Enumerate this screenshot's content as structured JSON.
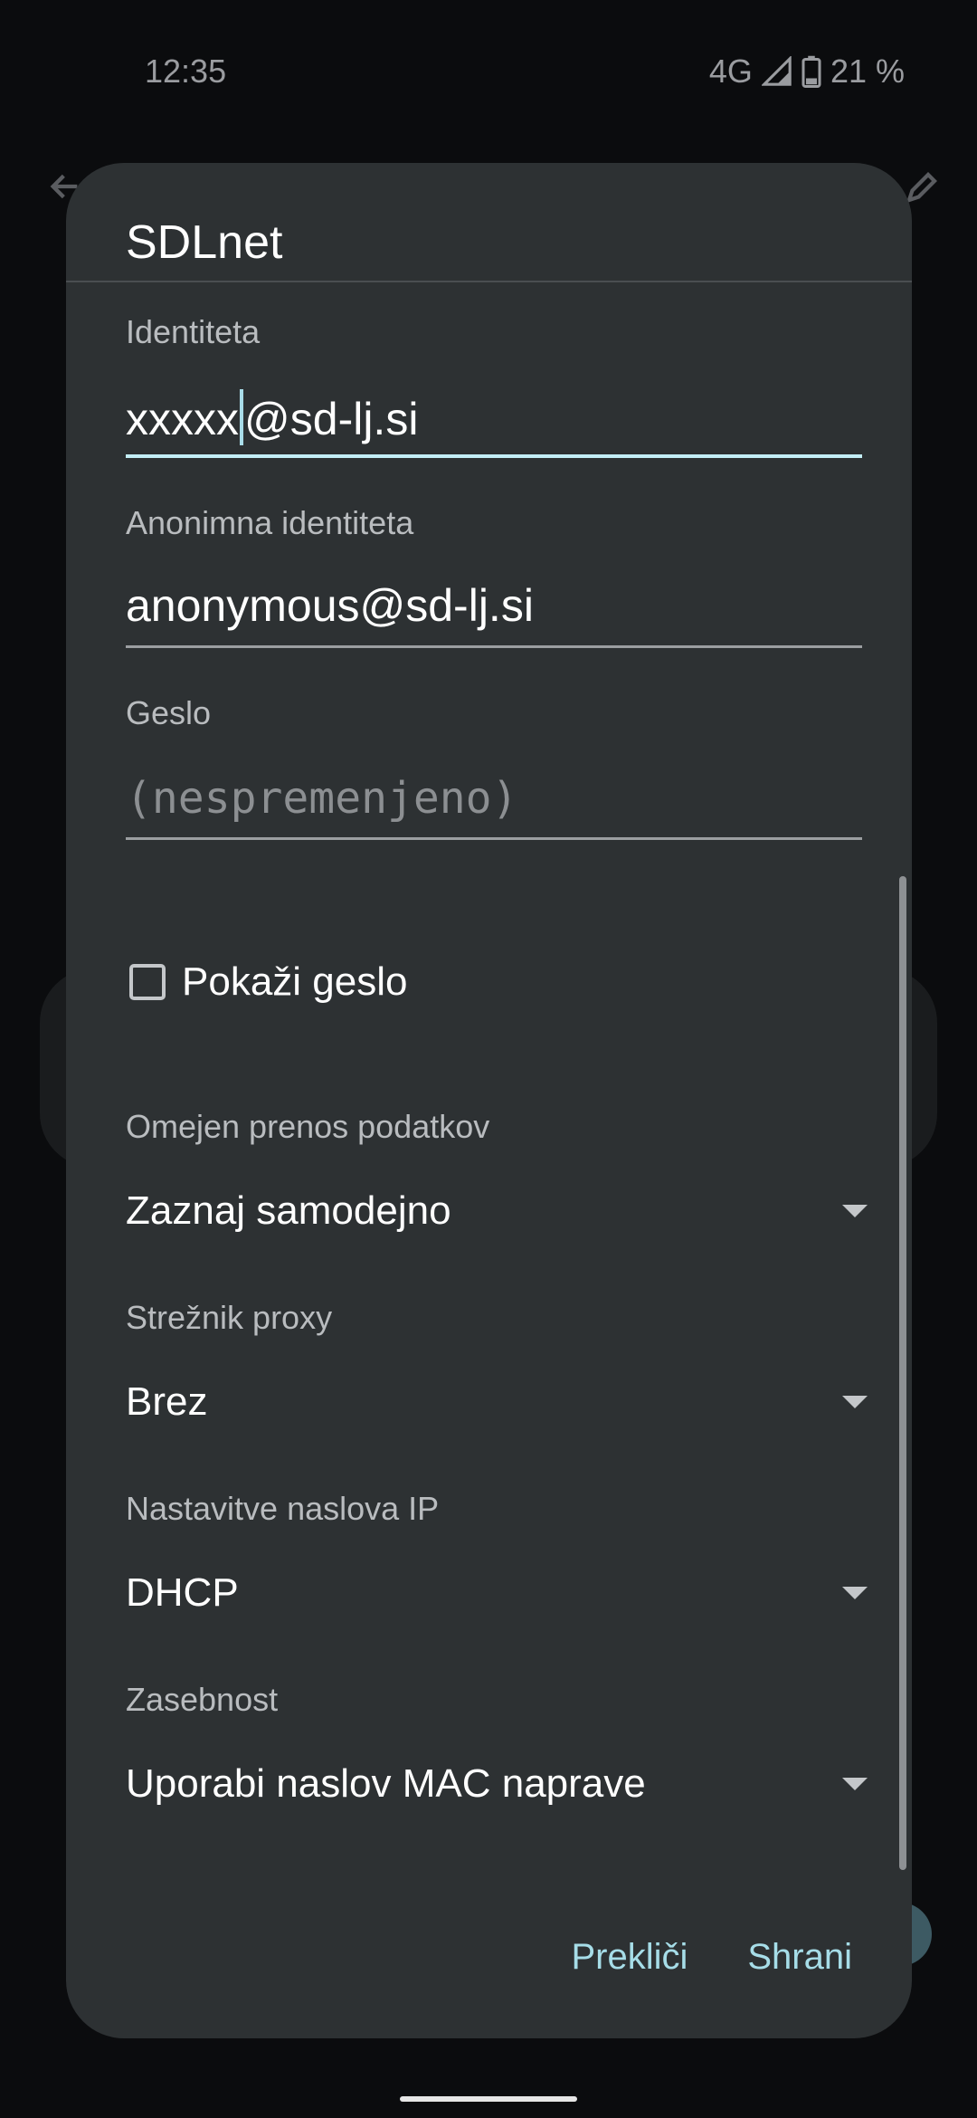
{
  "status_bar": {
    "time": "12:35",
    "network": "4G",
    "battery": "21 %"
  },
  "dialog": {
    "title": "SDLnet",
    "identity": {
      "label": "Identiteta",
      "value_before_cursor": "xxxxx",
      "value_after_cursor": "@sd-lj.si"
    },
    "anonymous_identity": {
      "label": "Anonimna identiteta",
      "value": "anonymous@sd-lj.si"
    },
    "password": {
      "label": "Geslo",
      "placeholder": "(nespremenjeno)"
    },
    "show_password": {
      "label": "Pokaži geslo",
      "checked": false
    },
    "metered": {
      "label": "Omejen prenos podatkov",
      "value": "Zaznaj samodejno"
    },
    "proxy": {
      "label": "Strežnik proxy",
      "value": "Brez"
    },
    "ip_settings": {
      "label": "Nastavitve naslova IP",
      "value": "DHCP"
    },
    "privacy": {
      "label": "Zasebnost",
      "value": "Uporabi naslov MAC naprave"
    },
    "actions": {
      "cancel": "Prekliči",
      "save": "Shrani"
    }
  },
  "colors": {
    "dialog_bg": "#2d3133",
    "accent": "#a6dde8",
    "active_underline": "#c3eef6"
  }
}
